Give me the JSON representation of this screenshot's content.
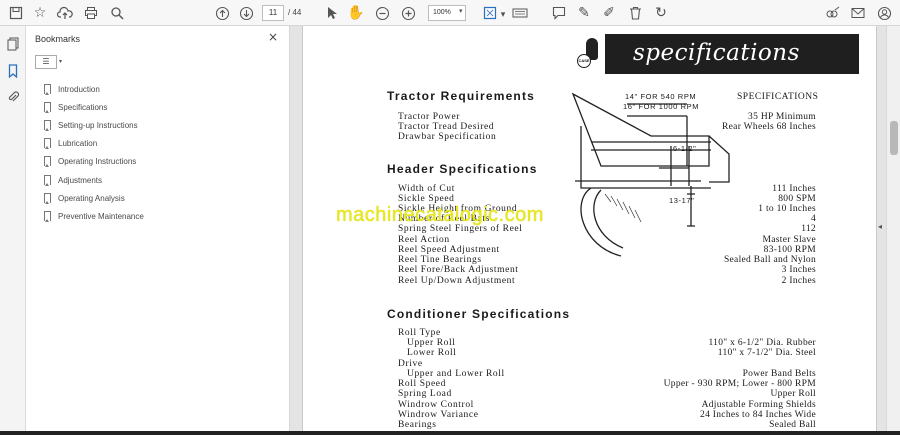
{
  "toolbar": {
    "page_current": "11",
    "page_total": "/ 44",
    "zoom": "100%"
  },
  "panel": {
    "title": "Bookmarks",
    "close": "×",
    "items": [
      {
        "label": "Introduction"
      },
      {
        "label": "Specifications"
      },
      {
        "label": "Setting-up Instructions"
      },
      {
        "label": "Lubrication"
      },
      {
        "label": "Operating Instructions"
      },
      {
        "label": "Adjustments"
      },
      {
        "label": "Operating Analysis"
      },
      {
        "label": "Preventive Maintenance"
      }
    ]
  },
  "document": {
    "banner_title": "specifications",
    "logo_text": "CASE",
    "diagram": {
      "label_540": "14\" FOR 540 RPM",
      "label_1000": "16\" FOR 1000 RPM",
      "label_612": "6-1/2\"",
      "label_1317": "13-17\""
    },
    "tractor": {
      "heading": "Tractor Requirements",
      "spec_label": "SPECIFICATIONS",
      "rows": [
        {
          "label": "Tractor Power",
          "value": "35 HP Minimum"
        },
        {
          "label": "Tractor Tread Desired",
          "value": "Rear Wheels 68 Inches"
        },
        {
          "label": "Drawbar Specification",
          "value": ""
        }
      ]
    },
    "header": {
      "heading": "Header Specifications",
      "rows": [
        {
          "label": "Width of Cut",
          "value": "111 Inches"
        },
        {
          "label": "Sickle Speed",
          "value": "800 SPM"
        },
        {
          "label": "Sickle Height from Ground",
          "value": "1 to 10 Inches"
        },
        {
          "label": "Number of Reel Bats",
          "value": "4"
        },
        {
          "label": "Spring Steel Fingers of Reel",
          "value": "112"
        },
        {
          "label": "Reel Action",
          "value": "Master Slave"
        },
        {
          "label": "Reel Speed Adjustment",
          "value": "83-100 RPM"
        },
        {
          "label": "Reel Tine Bearings",
          "value": "Sealed Ball and Nylon"
        },
        {
          "label": "Reel Fore/Back Adjustment",
          "value": "3 Inches"
        },
        {
          "label": "Reel Up/Down Adjustment",
          "value": "2 Inches"
        }
      ]
    },
    "conditioner": {
      "heading": "Conditioner Specifications",
      "rows": [
        {
          "label": "Roll Type",
          "value": "",
          "indent": false
        },
        {
          "label": "Upper Roll",
          "value": "110\" x 6-1/2\" Dia. Rubber",
          "indent": true
        },
        {
          "label": "Lower Roll",
          "value": "110\" x 7-1/2\" Dia. Steel",
          "indent": true
        },
        {
          "label": "Drive",
          "value": "",
          "indent": false
        },
        {
          "label": "Upper and Lower Roll",
          "value": "Power Band Belts",
          "indent": true
        },
        {
          "label": "Roll Speed",
          "value": "Upper - 930 RPM; Lower - 800 RPM",
          "indent": false
        },
        {
          "label": "Spring Load",
          "value": "Upper Roll",
          "indent": false
        },
        {
          "label": "Windrow Control",
          "value": "Adjustable Forming Shields",
          "indent": false
        },
        {
          "label": "Windrow Variance",
          "value": "24 Inches to 84 Inches Wide",
          "indent": false
        },
        {
          "label": "Bearings",
          "value": "Sealed Ball",
          "indent": false
        }
      ]
    },
    "watermark": "machinecatalogic.com"
  }
}
